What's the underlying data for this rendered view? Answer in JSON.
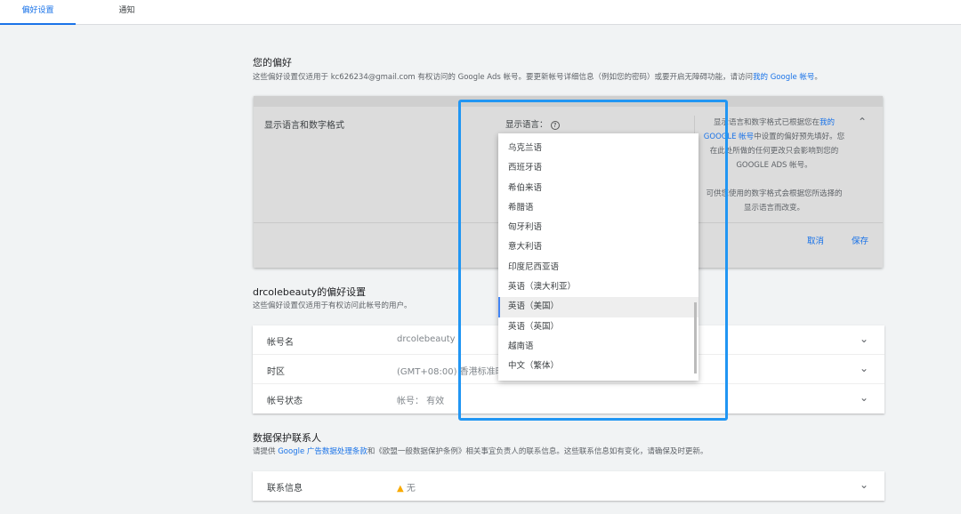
{
  "tabs": [
    {
      "label": "偏好设置",
      "active": true
    },
    {
      "label": "通知"
    }
  ],
  "your_prefs": {
    "title": "您的偏好",
    "desc": "这些偏好设置仅适用于 kc626234@gmail.com 有权访问的 Google Ads 帐号。要更新帐号详细信息（例如您的密码）或要开启无障碍功能，请访问",
    "desc_link": "我的 Google 帐号",
    "desc_end": "。"
  },
  "lang_card": {
    "title": "显示语言和数字格式",
    "field_label": "显示语言：",
    "help_icon": "help-circle-icon",
    "side_text_1": "显示语言和数字格式已根据您在",
    "side_link": "我的 GOOGLE 帐号",
    "side_text_2": "中设置的偏好预先填好。您在此处所做的任何更改只会影响到您的 GOOGLE ADS 帐号。",
    "side_text_3": "可供您使用的数字格式会根据您所选择的显示语言而改变。",
    "cancel": "取消",
    "save": "保存"
  },
  "dropdown": {
    "options": [
      "乌克兰语",
      "西班牙语",
      "希伯来语",
      "希腊语",
      "匈牙利语",
      "意大利语",
      "印度尼西亚语",
      "英语（澳大利亚）",
      "英语（美国）",
      "英语（英国）",
      "越南语",
      "中文（繁体）"
    ],
    "selected": "英语（美国）"
  },
  "account_prefs": {
    "title": "drcolebeauty的偏好设置",
    "desc": "这些偏好设置仅适用于有权访问此帐号的用户。",
    "rows": [
      {
        "label": "帐号名",
        "value": "drcolebeauty"
      },
      {
        "label": "时区",
        "value": "(GMT+08:00) 香港标准时间"
      },
      {
        "label": "帐号状态",
        "value": "帐号： 有效"
      }
    ]
  },
  "data_protection": {
    "title": "数据保护联系人",
    "desc_1": "请提供 ",
    "desc_link": "Google 广告数据处理条款",
    "desc_2": "和《欧盟一般数据保护条例》相关事宜负责人的联系信息。这些联系信息如有变化，请确保及时更新。",
    "row_label": "联系信息",
    "row_value": "无",
    "warning_icon": "warning-icon",
    "warning_color": "#f9ab00"
  },
  "highlight_color": "#2196f3"
}
